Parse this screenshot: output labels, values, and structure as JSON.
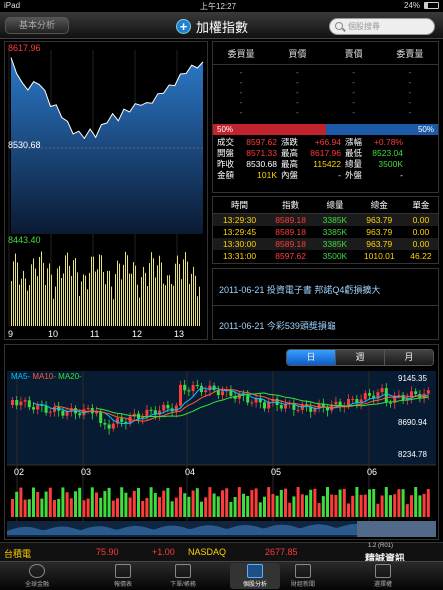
{
  "status_bar": {
    "device": "iPad",
    "time": "上午12:27",
    "battery": "24%"
  },
  "nav": {
    "back_label": "基本分析",
    "title": "加權指數",
    "search_placeholder": "個股搜尋"
  },
  "intraday": {
    "high_label": "8617.96",
    "mid_label": "8530.68",
    "low_label": "8443.40",
    "x_labels": [
      "9",
      "10",
      "11",
      "12",
      "13"
    ]
  },
  "orderbook": {
    "headers": [
      "委買量",
      "買價",
      "賣價",
      "委賣量"
    ],
    "rows": [
      [
        "-",
        "-",
        "-",
        "-"
      ],
      [
        "-",
        "-",
        "-",
        "-"
      ],
      [
        "-",
        "-",
        "-",
        "-"
      ],
      [
        "-",
        "-",
        "-",
        "-"
      ],
      [
        "-",
        "-",
        "-",
        "-"
      ]
    ],
    "buy_pct": "50%",
    "sell_pct": "50%"
  },
  "quote": {
    "rows": [
      [
        {
          "t": "成交",
          "c": "white"
        },
        {
          "t": "8597.62",
          "c": "red"
        },
        {
          "t": "漲跌",
          "c": "white"
        },
        {
          "t": "+66.94",
          "c": "red"
        },
        {
          "t": "漲幅",
          "c": "white"
        },
        {
          "t": "+0.78%",
          "c": "red"
        }
      ],
      [
        {
          "t": "開盤",
          "c": "white"
        },
        {
          "t": "8571.33",
          "c": "red"
        },
        {
          "t": "最高",
          "c": "white"
        },
        {
          "t": "8617.96",
          "c": "red"
        },
        {
          "t": "最低",
          "c": "white"
        },
        {
          "t": "8523.04",
          "c": "green"
        }
      ],
      [
        {
          "t": "昨收",
          "c": "white"
        },
        {
          "t": "8530.68",
          "c": "white"
        },
        {
          "t": "最高",
          "c": "white"
        },
        {
          "t": "115422",
          "c": "yellow"
        },
        {
          "t": "總量",
          "c": "white"
        },
        {
          "t": "3500K",
          "c": "green"
        }
      ],
      [
        {
          "t": "金額",
          "c": "white"
        },
        {
          "t": "101K",
          "c": "yellow"
        },
        {
          "t": "內盤",
          "c": "white"
        },
        {
          "t": "-",
          "c": "white"
        },
        {
          "t": "外盤",
          "c": "white"
        },
        {
          "t": "-",
          "c": "white"
        }
      ]
    ]
  },
  "trades": {
    "headers": [
      "時間",
      "指數",
      "總量",
      "總金",
      "單金"
    ],
    "rows": [
      [
        "13:29:30",
        "8589.18",
        "3385K",
        "963.79",
        "0.00"
      ],
      [
        "13:29:45",
        "8589.18",
        "3385K",
        "963.79",
        "0.00"
      ],
      [
        "13:30:00",
        "8589.18",
        "3385K",
        "963.79",
        "0.00"
      ],
      [
        "13:31:00",
        "8597.62",
        "3500K",
        "1010.01",
        "46.22"
      ]
    ]
  },
  "news": [
    "2011-06-21 投資電子書 邦諾Q4虧損擴大",
    "2011-06-21 今彩539頭獎損龜"
  ],
  "kline": {
    "periods": [
      "日",
      "週",
      "月"
    ],
    "active_period": "日",
    "ma_labels": [
      {
        "t": "MA5-",
        "c": "#00c8ff"
      },
      {
        "t": "MA10-",
        "c": "#ff5a3c"
      },
      {
        "t": "MA20-",
        "c": "#39e03a"
      }
    ],
    "price_labels": [
      "9145.35",
      "8690.94",
      "8234.78"
    ],
    "x_labels": [
      "02",
      "03",
      "04",
      "05",
      "06"
    ]
  },
  "ticker": {
    "left_name": "台積電",
    "left_price": "75.90",
    "left_change": "+1.00",
    "right_name": "NASDAQ",
    "right_price": "2677.85",
    "logo_version": "1.2 (R01)",
    "logo_text": "精誠資訊"
  },
  "tabs": [
    {
      "label": "全球金融",
      "icon": "globe-icon",
      "active": false
    },
    {
      "label": "報價表",
      "icon": "quote-list-icon",
      "active": false
    },
    {
      "label": "下單/帳務",
      "icon": "order-icon",
      "active": false
    },
    {
      "label": "個股分析",
      "icon": "analysis-chart-icon",
      "active": true
    },
    {
      "label": "財經新聞",
      "icon": "news-icon",
      "active": false
    },
    {
      "label": "選擇權",
      "icon": "options-icon",
      "active": false
    }
  ]
}
